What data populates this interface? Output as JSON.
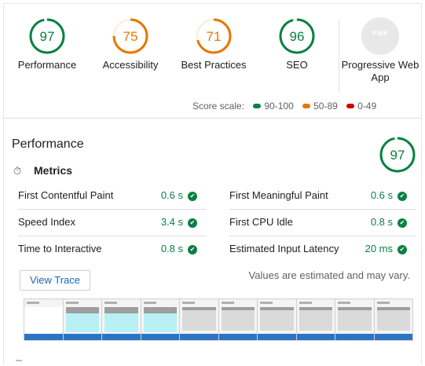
{
  "scores": [
    {
      "id": "performance",
      "value": "97",
      "label": "Performance",
      "color": "#0b8043",
      "fraction": 0.97
    },
    {
      "id": "accessibility",
      "value": "75",
      "label": "Accessibility",
      "color": "#e67700",
      "fraction": 0.75
    },
    {
      "id": "best-practices",
      "value": "71",
      "label": "Best Practices",
      "color": "#e67700",
      "fraction": 0.71
    },
    {
      "id": "seo",
      "value": "96",
      "label": "SEO",
      "color": "#0b8043",
      "fraction": 0.96
    }
  ],
  "pwa": {
    "badge": "PWA",
    "label": "Progressive Web App"
  },
  "scale": {
    "label": "Score scale:",
    "ranges": [
      {
        "text": "90-100",
        "color": "#0b8043"
      },
      {
        "text": "50-89",
        "color": "#e67700"
      },
      {
        "text": "0-49",
        "color": "#cc0000"
      }
    ]
  },
  "performance": {
    "title": "Performance",
    "score": "97",
    "score_fraction": 0.97,
    "metrics_title": "Metrics",
    "metrics": [
      {
        "label": "First Contentful Paint",
        "value": "0.6 s"
      },
      {
        "label": "First Meaningful Paint",
        "value": "0.6 s"
      },
      {
        "label": "Speed Index",
        "value": "3.4 s"
      },
      {
        "label": "First CPU Idle",
        "value": "0.8 s"
      },
      {
        "label": "Time to Interactive",
        "value": "0.8 s"
      },
      {
        "label": "Estimated Input Latency",
        "value": "20 ms"
      }
    ],
    "view_trace": "View Trace",
    "note": "Values are estimated and may vary."
  },
  "icons": {
    "metrics": "stopwatch-icon",
    "pass": "check-circle-icon"
  }
}
